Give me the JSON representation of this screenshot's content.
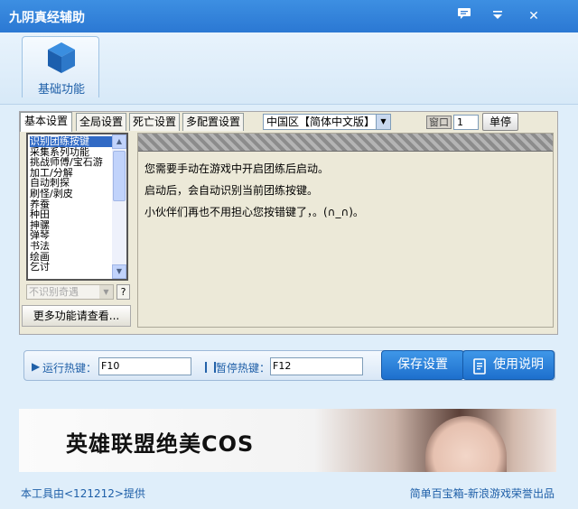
{
  "window": {
    "title": "九阴真经辅助",
    "controls": {
      "chat_icon": "chat-bubble-icon",
      "menu_icon": "dropdown-menu-icon",
      "close_label": "✕"
    }
  },
  "top_nav": {
    "feature_button_label": "基础功能",
    "feature_icon": "cube-icon"
  },
  "tabs": [
    {
      "label": "基本设置",
      "active": true
    },
    {
      "label": "全局设置",
      "active": false
    },
    {
      "label": "死亡设置",
      "active": false
    },
    {
      "label": "多配置设置",
      "active": false
    }
  ],
  "region_select": {
    "value": "中国区【简体中文版】"
  },
  "window_number": {
    "label": "窗口",
    "value": "1"
  },
  "single_stop_button": "单停",
  "function_list": {
    "items": [
      "识别团练按键",
      "采集系列功能",
      "挑战师傅/宝石游",
      "加工/分解",
      "自动刺探",
      "刷怪/剥皮",
      "养蚕",
      "种田",
      "抻骡",
      "弹琴",
      "书法",
      "绘画",
      "乞讨"
    ],
    "selected_index": 0
  },
  "encounter_select": {
    "value": "不识别奇遇"
  },
  "help_button": "?",
  "more_button": "更多功能请查看...",
  "description": [
    "您需要手动在游戏中开启团练后启动。",
    "启动后，会自动识别当前团练按键。",
    "小伙伴们再也不用担心您按错键了，。(∩_∩)。"
  ],
  "hotkeys": {
    "run_label": "运行热键：",
    "run_value": "F10",
    "pause_label": "暂停热键：",
    "pause_value": "F12"
  },
  "buttons": {
    "save": "保存设置",
    "manual": "使用说明"
  },
  "banner": {
    "text": "英雄联盟绝美COS"
  },
  "footer": {
    "left": "本工具由<121212>提供",
    "right": "简单百宝箱-新浪游戏荣誉出品"
  },
  "colors": {
    "title_bar": "#2b78d3",
    "accent": "#1e5fa8",
    "button": "#1d6fcd"
  }
}
